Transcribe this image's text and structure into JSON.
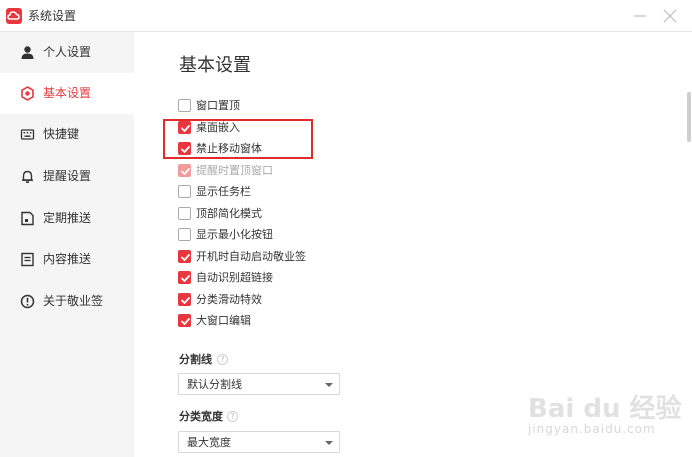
{
  "window": {
    "title": "系统设置",
    "logo_icon": "cloud-logo-icon",
    "accent_color": "#e8373e"
  },
  "sidebar": {
    "items": [
      {
        "label": "个人设置",
        "icon": "user-icon",
        "active": false
      },
      {
        "label": "基本设置",
        "icon": "settings-icon",
        "active": true
      },
      {
        "label": "快捷键",
        "icon": "keyboard-icon",
        "active": false
      },
      {
        "label": "提醒设置",
        "icon": "bell-icon",
        "active": false
      },
      {
        "label": "定期推送",
        "icon": "calendar-icon",
        "active": false
      },
      {
        "label": "内容推送",
        "icon": "document-icon",
        "active": false
      },
      {
        "label": "关于敬业签",
        "icon": "info-icon",
        "active": false
      }
    ]
  },
  "main": {
    "title": "基本设置",
    "checkboxes": [
      {
        "label": "窗口置顶",
        "checked": false,
        "disabled": false
      },
      {
        "label": "桌面嵌入",
        "checked": true,
        "disabled": false
      },
      {
        "label": "禁止移动窗体",
        "checked": true,
        "disabled": false
      },
      {
        "label": "提醒时置顶窗口",
        "checked": true,
        "disabled": true
      },
      {
        "label": "显示任务栏",
        "checked": false,
        "disabled": false
      },
      {
        "label": "顶部简化模式",
        "checked": false,
        "disabled": false
      },
      {
        "label": "显示最小化按钮",
        "checked": false,
        "disabled": false
      },
      {
        "label": "开机时自动启动敬业签",
        "checked": true,
        "disabled": false
      },
      {
        "label": "自动识别超链接",
        "checked": true,
        "disabled": false
      },
      {
        "label": "分类滑动特效",
        "checked": true,
        "disabled": false
      },
      {
        "label": "大窗口编辑",
        "checked": true,
        "disabled": false
      }
    ],
    "divider": {
      "label": "分割线",
      "help": "?",
      "value": "默认分割线"
    },
    "category_width": {
      "label": "分类宽度",
      "help": "?",
      "value": "最大宽度"
    }
  },
  "watermark": {
    "main": "Bai du 经验",
    "sub": "jingyan.baidu.com"
  }
}
